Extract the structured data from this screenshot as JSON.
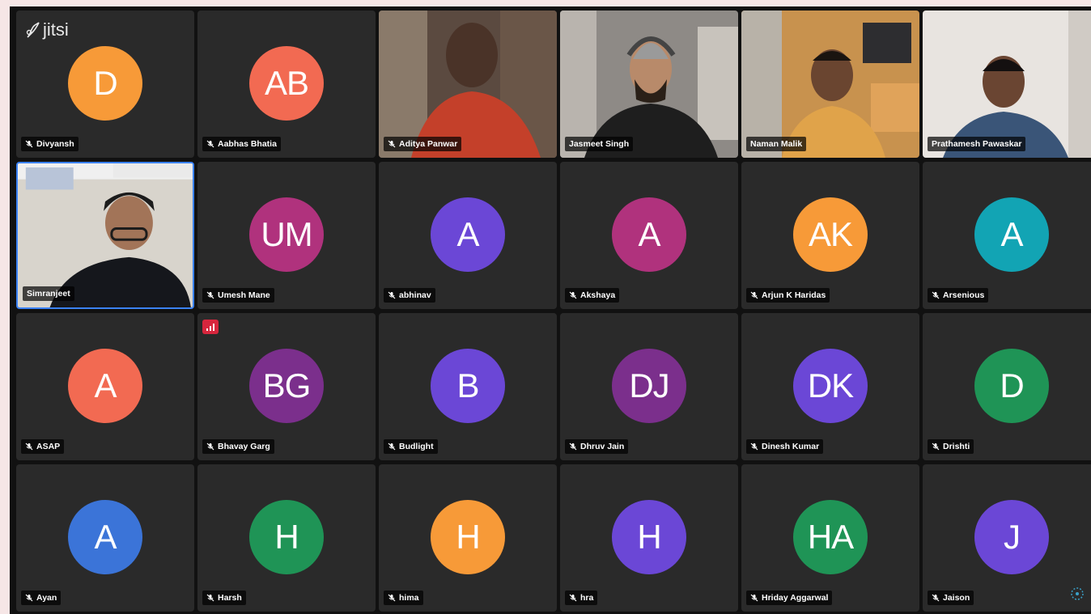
{
  "app": {
    "logo_text": "jitsi"
  },
  "video_participants": {
    "aditya": "Aditya Panwar",
    "jasmeet": "Jasmeet Singh",
    "naman": "Naman Malik",
    "prathamesh": "Prathamesh Pawaskar",
    "simranjeet": "Simranjeet"
  },
  "participants": [
    {
      "name": "Divyansh",
      "initials": "D",
      "color": "#f79a38"
    },
    {
      "name": "Aabhas Bhatia",
      "initials": "AB",
      "color": "#f26a52"
    },
    {
      "name": "Umesh Mane",
      "initials": "UM",
      "color": "#b0327d"
    },
    {
      "name": "abhinav",
      "initials": "A",
      "color": "#6b47d6"
    },
    {
      "name": "Akshaya",
      "initials": "A",
      "color": "#b0327d"
    },
    {
      "name": "Arjun K Haridas",
      "initials": "AK",
      "color": "#f79a38"
    },
    {
      "name": "Arsenious",
      "initials": "A",
      "color": "#12a4b4"
    },
    {
      "name": "ASAP",
      "initials": "A",
      "color": "#f26a52"
    },
    {
      "name": "Bhavay Garg",
      "initials": "BG",
      "color": "#7b2f8c"
    },
    {
      "name": "Budlight",
      "initials": "B",
      "color": "#6b47d6"
    },
    {
      "name": "Dhruv Jain",
      "initials": "DJ",
      "color": "#7b2f8c"
    },
    {
      "name": "Dinesh Kumar",
      "initials": "DK",
      "color": "#6b47d6"
    },
    {
      "name": "Drishti",
      "initials": "D",
      "color": "#1f9456"
    },
    {
      "name": "Ayan",
      "initials": "A",
      "color": "#3b74d8"
    },
    {
      "name": "Harsh",
      "initials": "H",
      "color": "#1f9456"
    },
    {
      "name": "hima",
      "initials": "H",
      "color": "#f79a38"
    },
    {
      "name": "hra",
      "initials": "H",
      "color": "#6b47d6"
    },
    {
      "name": "Hriday Aggarwal",
      "initials": "HA",
      "color": "#1f9456"
    },
    {
      "name": "Jaison",
      "initials": "J",
      "color": "#6b47d6"
    }
  ]
}
